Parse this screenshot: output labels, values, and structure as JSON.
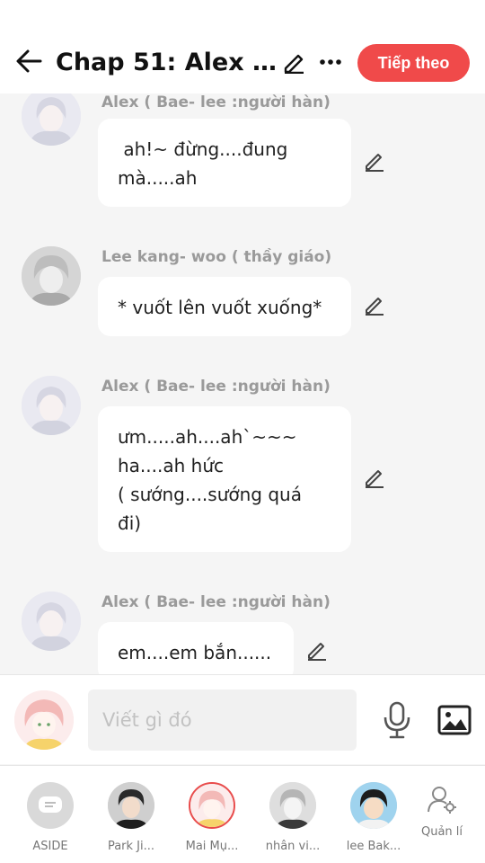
{
  "header": {
    "title": "Chap 51: Alex v...",
    "next_label": "Tiếp theo",
    "icons": {
      "back": "back-arrow-icon",
      "edit": "pencil-icon",
      "more": "more-dots-icon"
    }
  },
  "messages": [
    {
      "sender": "Alex (  Bae- lee :người hàn)",
      "text": " ah!~ đừng....đung\nmà.....ah"
    },
    {
      "sender": "Lee kang- woo ( thầy giáo)",
      "text": "* vuốt lên vuốt xuống*"
    },
    {
      "sender": "Alex (  Bae- lee :người hàn)",
      "text": "ưm.....ah....ah`~~~\nha....ah hức\n( sướng....sướng quá\nđi)"
    },
    {
      "sender": "Alex (  Bae- lee :người hàn)",
      "text": "em....em bắn......"
    }
  ],
  "composer": {
    "placeholder": "Viết gì đó",
    "icons": {
      "mic": "microphone-icon",
      "image": "image-icon"
    }
  },
  "characters": [
    {
      "label": "ASIDE",
      "icon": "aside-chat-icon"
    },
    {
      "label": "Park Ji..."
    },
    {
      "label": "Mai Mụ...",
      "selected": true
    },
    {
      "label": "nhân vi..."
    },
    {
      "label": "lee Bak..."
    }
  ],
  "manage_label": "Quản lí",
  "colors": {
    "accent": "#f04a4a",
    "background": "#f5f5f5",
    "bubble": "#ffffff",
    "sender": "#9a9a9a"
  }
}
